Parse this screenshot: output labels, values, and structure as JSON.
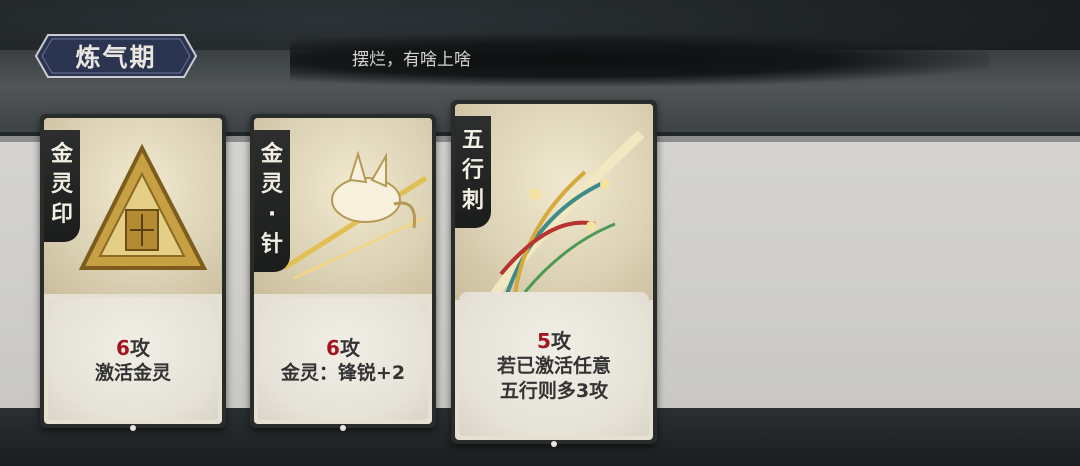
{
  "header": {
    "realm_label": "炼气期",
    "motto": "摆烂，有啥上啥"
  },
  "cards": [
    {
      "name": [
        "金",
        "灵",
        "印"
      ],
      "attack_value": "6",
      "attack_unit": "攻",
      "effect_lines": [
        "激活金灵"
      ]
    },
    {
      "name": [
        "金",
        "灵",
        "·",
        "针"
      ],
      "attack_value": "6",
      "attack_unit": "攻",
      "effect_lines": [
        "金灵：锋锐+2"
      ]
    },
    {
      "name": [
        "五",
        "行",
        "刺"
      ],
      "attack_value": "5",
      "attack_unit": "攻",
      "effect_lines": [
        "若已激活任意",
        "五行则多3攻"
      ]
    }
  ],
  "colors": {
    "attack_number": "#a3161d",
    "badge_fill": "#2b3450"
  }
}
